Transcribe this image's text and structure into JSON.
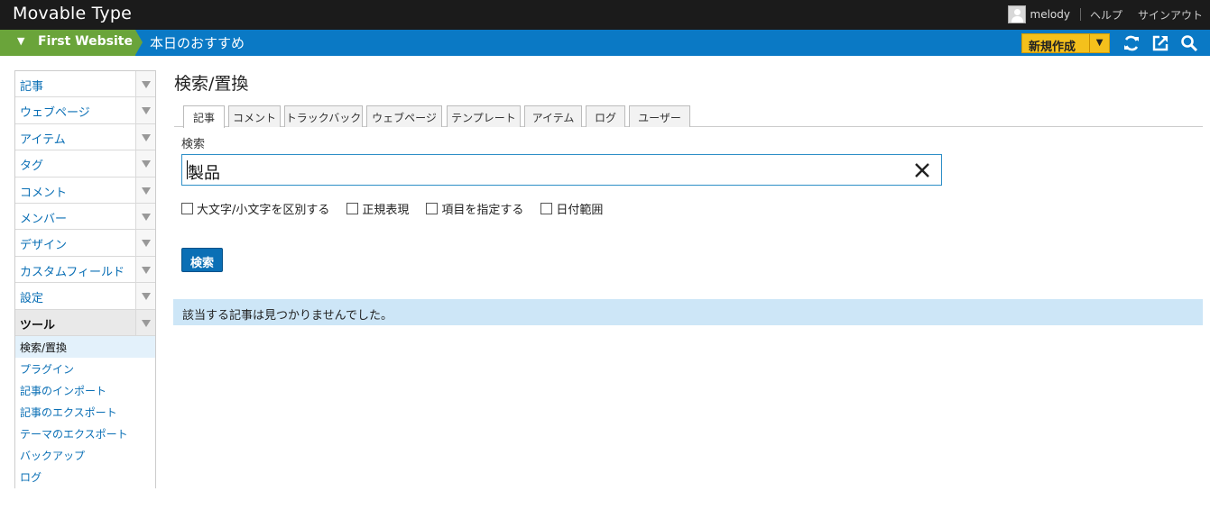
{
  "app": {
    "title": "Movable Type"
  },
  "user": {
    "name": "melody",
    "help": "ヘルプ",
    "signout": "サインアウト"
  },
  "context": {
    "site": "First Website",
    "blog": "本日のおすすめ",
    "new_button": "新規作成"
  },
  "icons": [
    "refresh-icon",
    "external-link-icon",
    "search-icon",
    "close-icon",
    "chevron-down-icon"
  ],
  "colors": {
    "topbar": "#1b1b1b",
    "bluebar": "#0a79c5",
    "site_tab": "#6aa43a",
    "new_button": "#f4c01c",
    "notice": "#cde6f7"
  },
  "sidebar": {
    "items": [
      {
        "label": "記事"
      },
      {
        "label": "ウェブページ"
      },
      {
        "label": "アイテム"
      },
      {
        "label": "タグ"
      },
      {
        "label": "コメント"
      },
      {
        "label": "メンバー"
      },
      {
        "label": "デザイン"
      },
      {
        "label": "カスタムフィールド"
      },
      {
        "label": "設定"
      },
      {
        "label": "ツール"
      }
    ],
    "tools_sub": [
      {
        "label": "検索/置換"
      },
      {
        "label": "プラグイン"
      },
      {
        "label": "記事のインポート"
      },
      {
        "label": "記事のエクスポート"
      },
      {
        "label": "テーマのエクスポート"
      },
      {
        "label": "バックアップ"
      },
      {
        "label": "ログ"
      }
    ]
  },
  "main": {
    "title": "検索/置換",
    "tabs": [
      {
        "label": "記事"
      },
      {
        "label": "コメント"
      },
      {
        "label": "トラックバック"
      },
      {
        "label": "ウェブページ"
      },
      {
        "label": "テンプレート"
      },
      {
        "label": "アイテム"
      },
      {
        "label": "ログ"
      },
      {
        "label": "ユーザー"
      }
    ],
    "search_label": "検索",
    "search_value": "製品",
    "options": [
      {
        "label": "大文字/小文字を区別する",
        "checked": false
      },
      {
        "label": "正規表現",
        "checked": false
      },
      {
        "label": "項目を指定する",
        "checked": false
      },
      {
        "label": "日付範囲",
        "checked": false
      }
    ],
    "submit": "検索",
    "result": "該当する記事は見つかりませんでした。"
  }
}
